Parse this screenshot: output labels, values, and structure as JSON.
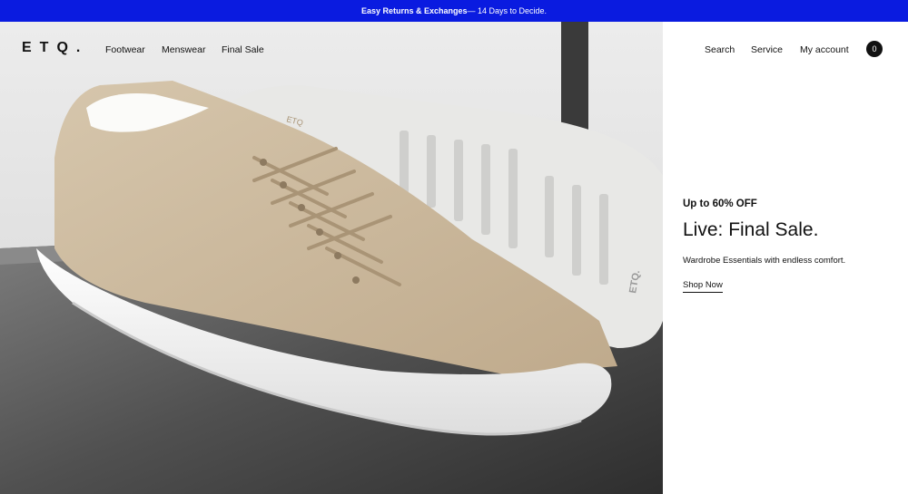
{
  "announcement": {
    "bold": "Easy Returns & Exchanges",
    "rest": " — 14 Days to Decide."
  },
  "header": {
    "logo": "ETQ.",
    "nav_left": [
      "Footwear",
      "Menswear",
      "Final Sale"
    ],
    "nav_right": [
      "Search",
      "Service",
      "My account"
    ],
    "cart_count": "0"
  },
  "promo": {
    "eyebrow": "Up to 60% OFF",
    "title": "Live: Final Sale.",
    "subtitle": "Wardrobe Essentials with endless comfort.",
    "cta": "Shop Now"
  },
  "hero_image": {
    "sole_brand_mark": "ETQ.",
    "tongue_brand_mark": "ETQ"
  },
  "colors": {
    "announcement_bg": "#0a1be0",
    "suede": "#cbb99e",
    "sole": "#f3f3f1",
    "bench": "#5b5b5b"
  }
}
